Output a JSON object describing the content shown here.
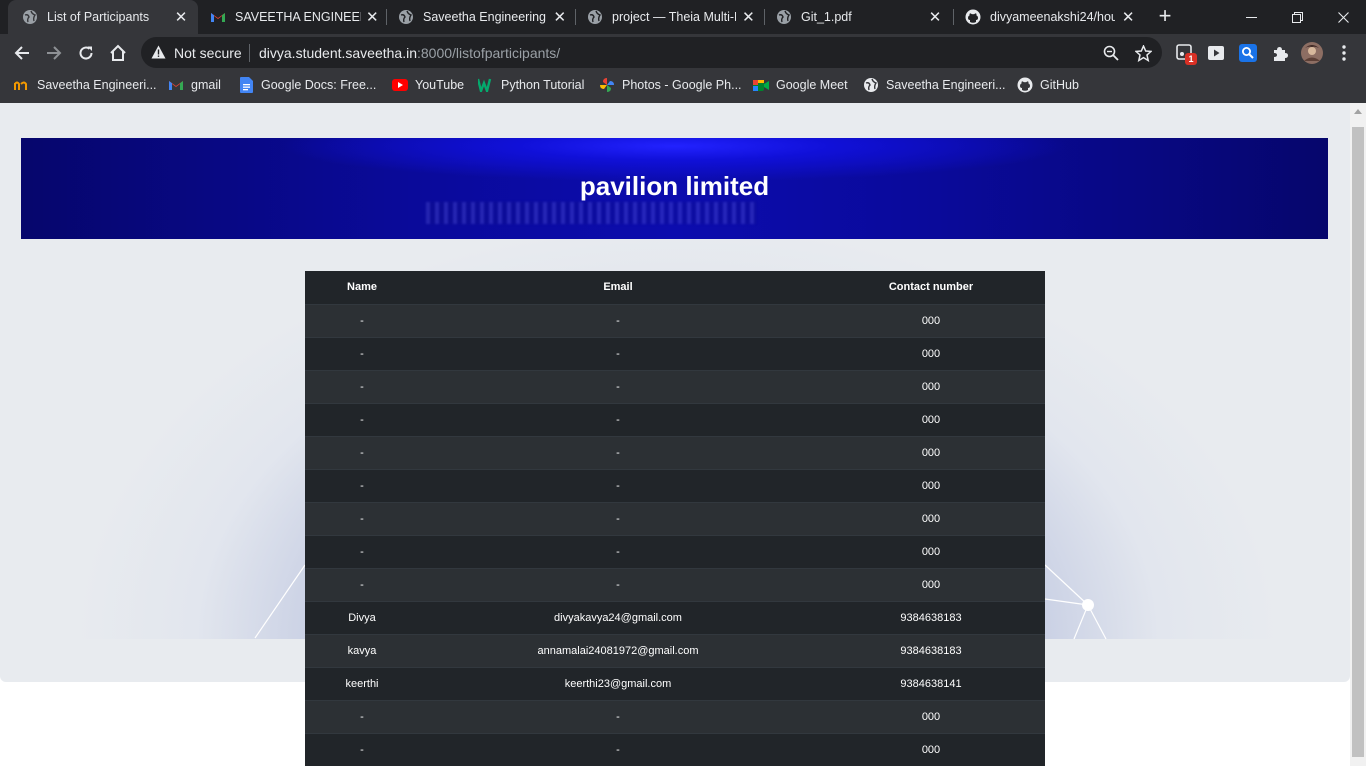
{
  "browser": {
    "tabs": [
      {
        "title": "List of Participants",
        "icon": "globe-icon",
        "active": true
      },
      {
        "title": "SAVEETHA ENGINEERIN",
        "icon": "gmail-icon",
        "active": false
      },
      {
        "title": "Saveetha Engineering C",
        "icon": "globe-icon",
        "active": false
      },
      {
        "title": "project — Theia Multi-L",
        "icon": "globe-icon",
        "active": false
      },
      {
        "title": "Git_1.pdf",
        "icon": "globe-icon",
        "active": false
      },
      {
        "title": "divyameenakshi24/hou",
        "icon": "github-icon",
        "active": false
      }
    ],
    "address": {
      "security_label": "Not secure",
      "host": "divya.student.saveetha.in",
      "path": ":8000/listofparticipants/"
    },
    "extension_badge": "1",
    "bookmarks": [
      {
        "label": "Saveetha Engineeri...",
        "icon": "saveetha-icon"
      },
      {
        "label": "gmail",
        "icon": "gmail-icon"
      },
      {
        "label": "Google Docs: Free...",
        "icon": "docs-icon"
      },
      {
        "label": "YouTube",
        "icon": "youtube-icon"
      },
      {
        "label": "Python Tutorial",
        "icon": "w3-icon"
      },
      {
        "label": "Photos - Google Ph...",
        "icon": "photos-icon"
      },
      {
        "label": "Google Meet",
        "icon": "meet-icon"
      },
      {
        "label": "Saveetha Engineeri...",
        "icon": "globe-icon"
      },
      {
        "label": "GitHub",
        "icon": "github-icon"
      }
    ]
  },
  "page": {
    "banner_title": "pavilion limited",
    "table": {
      "headers": [
        "Name",
        "Email",
        "Contact number"
      ],
      "rows": [
        [
          "-",
          "-",
          "000"
        ],
        [
          "-",
          "-",
          "000"
        ],
        [
          "-",
          "-",
          "000"
        ],
        [
          "-",
          "-",
          "000"
        ],
        [
          "-",
          "-",
          "000"
        ],
        [
          "-",
          "-",
          "000"
        ],
        [
          "-",
          "-",
          "000"
        ],
        [
          "-",
          "-",
          "000"
        ],
        [
          "-",
          "-",
          "000"
        ],
        [
          "Divya",
          "divyakavya24@gmail.com",
          "9384638183"
        ],
        [
          "kavya",
          "annamalai24081972@gmail.com",
          "9384638183"
        ],
        [
          "keerthi",
          "keerthi23@gmail.com",
          "9384638141"
        ],
        [
          "-",
          "-",
          "000"
        ],
        [
          "-",
          "-",
          "000"
        ]
      ]
    }
  },
  "colors": {
    "banner": "#0a0a9a",
    "table_bg": "#212529",
    "table_stripe": "#2c3034",
    "page_bg": "#e8ebef"
  }
}
